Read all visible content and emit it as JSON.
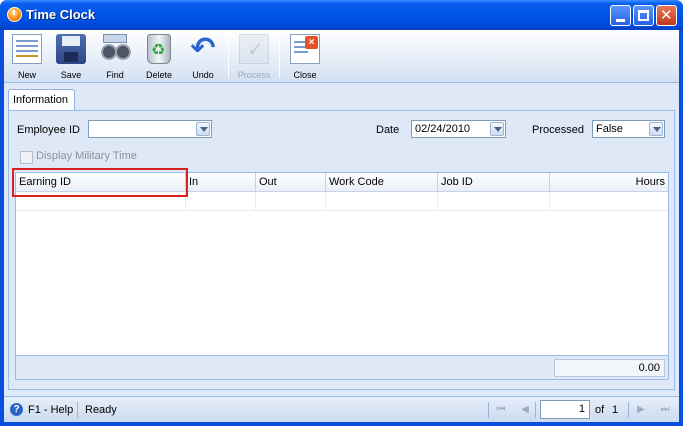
{
  "window": {
    "title": "Time Clock"
  },
  "toolbar": {
    "items": [
      {
        "label": "New"
      },
      {
        "label": "Save"
      },
      {
        "label": "Find"
      },
      {
        "label": "Delete"
      },
      {
        "label": "Undo"
      },
      {
        "label": "Process"
      },
      {
        "label": "Close"
      }
    ]
  },
  "tabs": [
    {
      "label": "Information"
    }
  ],
  "form": {
    "employee_id_label": "Employee ID",
    "employee_id_value": "",
    "date_label": "Date",
    "date_value": "02/24/2010",
    "processed_label": "Processed",
    "processed_value": "False",
    "military_time_label": "Display Military Time"
  },
  "grid": {
    "columns": [
      "Earning ID",
      "In",
      "Out",
      "Work Code",
      "Job ID",
      "Hours"
    ],
    "rows": [],
    "total_hours": "0.00"
  },
  "status": {
    "help": "F1 - Help",
    "state": "Ready",
    "page": "1",
    "of_label": "of",
    "total_pages": "1"
  }
}
